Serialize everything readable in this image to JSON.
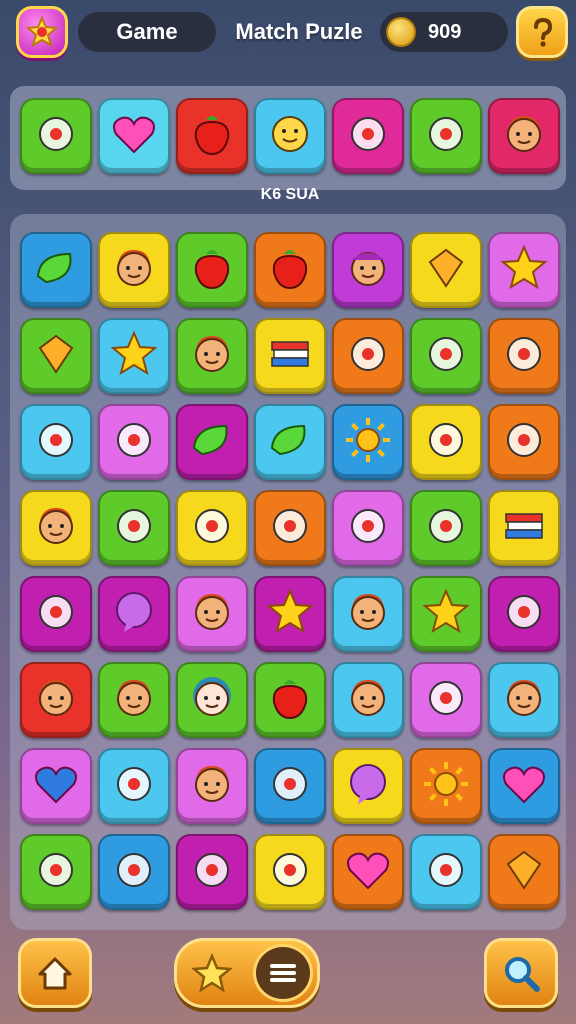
{
  "header": {
    "game_label": "Game",
    "title": "Match Puzle",
    "coins": "909",
    "profile_icon": "star-badge-icon",
    "help_icon": "question-icon"
  },
  "strip_label": "K6 SUA",
  "top_strip": [
    {
      "color": "#5ecb2b",
      "icon": "milk-character"
    },
    {
      "color": "#58d6f0",
      "icon": "heart"
    },
    {
      "color": "#e8322a",
      "icon": "strawberry"
    },
    {
      "color": "#4cc8f0",
      "icon": "smiley"
    },
    {
      "color": "#e02a9a",
      "icon": "balloon-fish"
    },
    {
      "color": "#5ecb2b",
      "icon": "ribbon"
    },
    {
      "color": "#e3286a",
      "icon": "face"
    }
  ],
  "board": [
    [
      {
        "color": "#2f9be0",
        "icon": "leaf"
      },
      {
        "color": "#f6d81c",
        "icon": "face"
      },
      {
        "color": "#5ecb2b",
        "icon": "chili"
      },
      {
        "color": "#f07a1a",
        "icon": "pepper"
      },
      {
        "color": "#c03bd8",
        "icon": "face-hat"
      },
      {
        "color": "#f6d81c",
        "icon": "gem"
      },
      {
        "color": "#e06ae8",
        "icon": "star"
      }
    ],
    [
      {
        "color": "#5ecb2b",
        "icon": "box"
      },
      {
        "color": "#4cc8f0",
        "icon": "star-wand"
      },
      {
        "color": "#5ecb2b",
        "icon": "face"
      },
      {
        "color": "#f6d81c",
        "icon": "books"
      },
      {
        "color": "#f07a1a",
        "icon": "bell"
      },
      {
        "color": "#5ecb2b",
        "icon": "fruit"
      },
      {
        "color": "#f07a1a",
        "icon": "paper"
      }
    ],
    [
      {
        "color": "#4cc8f0",
        "icon": "brush"
      },
      {
        "color": "#e06ae8",
        "icon": "radio"
      },
      {
        "color": "#c01fb0",
        "icon": "plant"
      },
      {
        "color": "#4cc8f0",
        "icon": "leaf-ball"
      },
      {
        "color": "#2f9be0",
        "icon": "sun"
      },
      {
        "color": "#f6d81c",
        "icon": "flower-face"
      },
      {
        "color": "#f07a1a",
        "icon": "heart-sprout"
      }
    ],
    [
      {
        "color": "#f6d81c",
        "icon": "face"
      },
      {
        "color": "#5ecb2b",
        "icon": "cloud-face"
      },
      {
        "color": "#f6d81c",
        "icon": "camera-hat"
      },
      {
        "color": "#f07a1a",
        "icon": "banana"
      },
      {
        "color": "#e06ae8",
        "icon": "gear-gem"
      },
      {
        "color": "#5ecb2b",
        "icon": "lemon"
      },
      {
        "color": "#f6d81c",
        "icon": "books"
      }
    ],
    [
      {
        "color": "#c01fb0",
        "icon": "cupcake"
      },
      {
        "color": "#c01fb0",
        "icon": "bubble"
      },
      {
        "color": "#e06ae8",
        "icon": "face"
      },
      {
        "color": "#c01fb0",
        "icon": "star"
      },
      {
        "color": "#4cc8f0",
        "icon": "face"
      },
      {
        "color": "#5ecb2b",
        "icon": "star"
      },
      {
        "color": "#c01fb0",
        "icon": "temple"
      }
    ],
    [
      {
        "color": "#e8322a",
        "icon": "face"
      },
      {
        "color": "#5ecb2b",
        "icon": "face"
      },
      {
        "color": "#5ecb2b",
        "icon": "face-hair"
      },
      {
        "color": "#5ecb2b",
        "icon": "apple"
      },
      {
        "color": "#4cc8f0",
        "icon": "face"
      },
      {
        "color": "#e06ae8",
        "icon": "jelly"
      },
      {
        "color": "#4cc8f0",
        "icon": "face"
      }
    ],
    [
      {
        "color": "#e06ae8",
        "icon": "heart-swirl"
      },
      {
        "color": "#4cc8f0",
        "icon": "sunglasses"
      },
      {
        "color": "#e06ae8",
        "icon": "face"
      },
      {
        "color": "#2f9be0",
        "icon": "slingshot"
      },
      {
        "color": "#f6d81c",
        "icon": "bubble"
      },
      {
        "color": "#f07a1a",
        "icon": "sun"
      },
      {
        "color": "#2f9be0",
        "icon": "heart"
      }
    ],
    [
      {
        "color": "#5ecb2b",
        "icon": "donut"
      },
      {
        "color": "#2f9be0",
        "icon": "cake"
      },
      {
        "color": "#c01fb0",
        "icon": "robot"
      },
      {
        "color": "#f6d81c",
        "icon": "fish"
      },
      {
        "color": "#f07a1a",
        "icon": "heart"
      },
      {
        "color": "#4cc8f0",
        "icon": "frame"
      },
      {
        "color": "#f07a1a",
        "icon": "block"
      }
    ]
  ],
  "footer": {
    "home_icon": "home-icon",
    "star_icon": "star-icon",
    "menu_icon": "menu-icon",
    "search_icon": "search-icon"
  }
}
